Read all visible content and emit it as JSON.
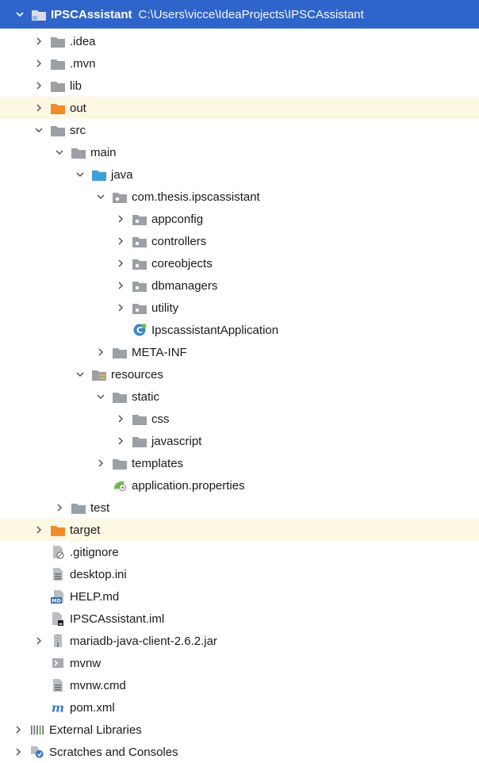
{
  "colors": {
    "selected_bg": "#2f65ca",
    "excluded_bg": "#fdf8e3",
    "folder": "#9aa0a6",
    "excluded_folder": "#f08c2c",
    "source_folder": "#3d9fd8"
  },
  "project": {
    "name": "IPSCAssistant",
    "path": "C:\\Users\\vicce\\IdeaProjects\\IPSCAssistant"
  },
  "items": [
    {
      "label": ".idea",
      "icon": "folder-icon"
    },
    {
      "label": ".mvn",
      "icon": "folder-icon"
    },
    {
      "label": "lib",
      "icon": "folder-icon"
    },
    {
      "label": "out",
      "icon": "excluded-folder-icon"
    },
    {
      "label": "src",
      "icon": "folder-icon"
    },
    {
      "label": "main",
      "icon": "folder-icon"
    },
    {
      "label": "java",
      "icon": "source-folder-icon"
    },
    {
      "label": "com.thesis.ipscassistant",
      "icon": "package-icon"
    },
    {
      "label": "appconfig",
      "icon": "package-icon"
    },
    {
      "label": "controllers",
      "icon": "package-icon"
    },
    {
      "label": "coreobjects",
      "icon": "package-icon"
    },
    {
      "label": "dbmanagers",
      "icon": "package-icon"
    },
    {
      "label": "utility",
      "icon": "package-icon"
    },
    {
      "label": "IpscassistantApplication",
      "icon": "spring-class-icon"
    },
    {
      "label": "META-INF",
      "icon": "folder-icon"
    },
    {
      "label": "resources",
      "icon": "resources-folder-icon"
    },
    {
      "label": "static",
      "icon": "folder-icon"
    },
    {
      "label": "css",
      "icon": "folder-icon"
    },
    {
      "label": "javascript",
      "icon": "folder-icon"
    },
    {
      "label": "templates",
      "icon": "folder-icon"
    },
    {
      "label": "application.properties",
      "icon": "spring-properties-icon"
    },
    {
      "label": "test",
      "icon": "folder-icon"
    },
    {
      "label": "target",
      "icon": "excluded-folder-icon"
    },
    {
      "label": ".gitignore",
      "icon": "gitignore-file-icon"
    },
    {
      "label": "desktop.ini",
      "icon": "text-file-icon"
    },
    {
      "label": "HELP.md",
      "icon": "markdown-file-icon"
    },
    {
      "label": "IPSCAssistant.iml",
      "icon": "iml-file-icon"
    },
    {
      "label": "mariadb-java-client-2.6.2.jar",
      "icon": "jar-file-icon"
    },
    {
      "label": "mvnw",
      "icon": "shell-file-icon"
    },
    {
      "label": "mvnw.cmd",
      "icon": "text-file-icon"
    },
    {
      "label": "pom.xml",
      "icon": "maven-icon"
    },
    {
      "label": "External Libraries",
      "icon": "libraries-icon"
    },
    {
      "label": "Scratches and Consoles",
      "icon": "scratches-icon"
    }
  ]
}
